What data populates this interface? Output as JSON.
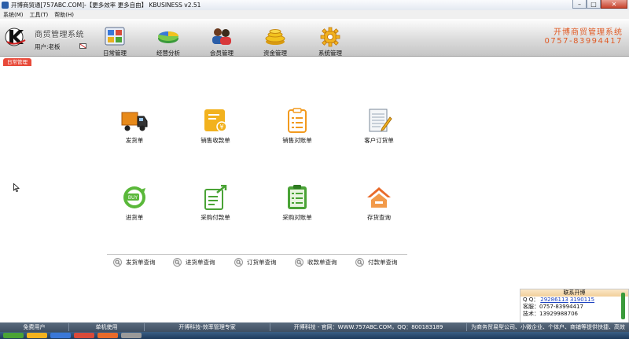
{
  "window": {
    "title": "开博商贸通[757ABC.COM]-【更多效率 更多自由】  KBUSINESS v2.51"
  },
  "menu": [
    "系统(M)",
    "工具(T)",
    "帮助(H)"
  ],
  "header": {
    "system_name": "商贸管理系统",
    "user_label": "用户:老板",
    "modules": [
      "日常管理",
      "经营分析",
      "会员管理",
      "资金管理",
      "系统管理"
    ],
    "hotline_line1": "开博商贸管理系统",
    "hotline_line2": "0757-83994417"
  },
  "section_tab": "日常管理",
  "main": {
    "row1": [
      "发货单",
      "销售收款单",
      "销售对账单",
      "客户订货单"
    ],
    "row2": [
      "进货单",
      "采购付款单",
      "采购对账单",
      "存货查询"
    ],
    "queries": [
      "发货单查询",
      "进货单查询",
      "订货单查询",
      "收款单查询",
      "付款单查询"
    ]
  },
  "contact": {
    "title": "联系开博",
    "qq_label": "Q Q：",
    "qq1": "29286113",
    "qq2": "3190115",
    "service": "客服：0757-83994417",
    "tech": "技术：13929988706"
  },
  "statusbar": [
    "免费用户",
    "单机使用",
    "开博科技-效率管理专家",
    "开博科技 - 官网：WWW.757ABC.COM，QQ：800183189",
    "为商务贸易型公司、小微企业、个体户、商铺等提供快捷、高效"
  ],
  "colors": {
    "accent_red": "#e84a3a",
    "hotline_orange": "#e05a24",
    "status_bg": "#4a5b6e",
    "icon_orange": "#f29a1e",
    "icon_green": "#4aa336"
  }
}
